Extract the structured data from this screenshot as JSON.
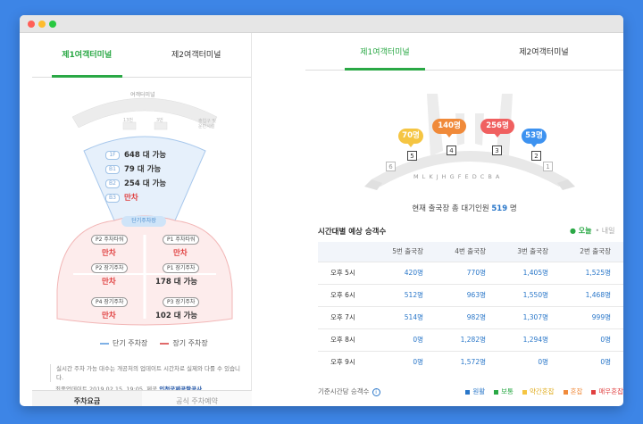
{
  "colors": {
    "green": "#2aa845",
    "blue": "#2a77c9",
    "red": "#e04040",
    "orange": "#f0a84a"
  },
  "left": {
    "tabs": [
      "제1여객터미널",
      "제2여객터미널"
    ],
    "terminal_label": "여객터미널",
    "gate_left": "13번",
    "gate_right": "3번",
    "side_note": "출입구 및 운반시설",
    "floors": [
      {
        "badge": "1F",
        "value": "648 대 가능"
      },
      {
        "badge": "B1",
        "value": "79 대 가능"
      },
      {
        "badge": "B2",
        "value": "254 대 가능"
      },
      {
        "badge": "B3",
        "value": "만차"
      }
    ],
    "short_term_label": "단기주차장",
    "lots": [
      {
        "name": "P2 주차타워",
        "value": "만차"
      },
      {
        "name": "P1 주차타워",
        "value": "만차"
      },
      {
        "name": "P2 장기주차",
        "value": "만차"
      },
      {
        "name": "P1 장기주차",
        "value": "178 대 가능"
      },
      {
        "name": "P4 장기주차",
        "value": "만차"
      },
      {
        "name": "P3 장기주차",
        "value": "102 대 가능"
      }
    ],
    "legend": {
      "short": "단기 주차장",
      "long": "장기 주차장"
    },
    "notice": "실시간 주차 가능 대수는 개공처의 업데이트 시간차로 실제와 다를 수 있습니다.",
    "update_prefix": "최종업데이트 2019.02.15. 19:05",
    "update_mid": "제공",
    "update_org": "인천국제공항공사",
    "bottom_tabs": [
      "주차요금",
      "공식 주차예약"
    ]
  },
  "right": {
    "tabs": [
      "제1여객터미널",
      "제2여객터미널"
    ],
    "bubbles": [
      "70명",
      "140명",
      "256명",
      "53명"
    ],
    "gates": [
      "5",
      "4",
      "3",
      "2"
    ],
    "small_gates": [
      "6",
      "1"
    ],
    "letters": "M L K J H G  F E D C B A",
    "waiting_prefix": "현재 출국장 총 대기인원",
    "waiting_num": "519",
    "waiting_suffix": "명",
    "table_title": "시간대별 예상 승객수",
    "today": "● 오늘",
    "tomorrow": "• 내일",
    "columns": [
      "",
      "5번 출국장",
      "4번 출국장",
      "3번 출국장",
      "2번 출국장"
    ],
    "rows": [
      [
        "오후 5시",
        "420명",
        "770명",
        "1,405명",
        "1,525명"
      ],
      [
        "오후 6시",
        "512명",
        "963명",
        "1,550명",
        "1,468명"
      ],
      [
        "오후 7시",
        "514명",
        "982명",
        "1,307명",
        "999명"
      ],
      [
        "오후 8시",
        "0명",
        "1,282명",
        "1,294명",
        "0명"
      ],
      [
        "오후 9시",
        "0명",
        "1,572명",
        "0명",
        "0명"
      ]
    ],
    "footer_label": "기준시간당 승객수",
    "status_legend": [
      {
        "label": "원활",
        "color": "#2a77c9"
      },
      {
        "label": "보통",
        "color": "#2aa845"
      },
      {
        "label": "약간혼잡",
        "color": "#f5c542"
      },
      {
        "label": "혼잡",
        "color": "#f08a3a"
      },
      {
        "label": "매우혼잡",
        "color": "#e04040"
      }
    ]
  }
}
